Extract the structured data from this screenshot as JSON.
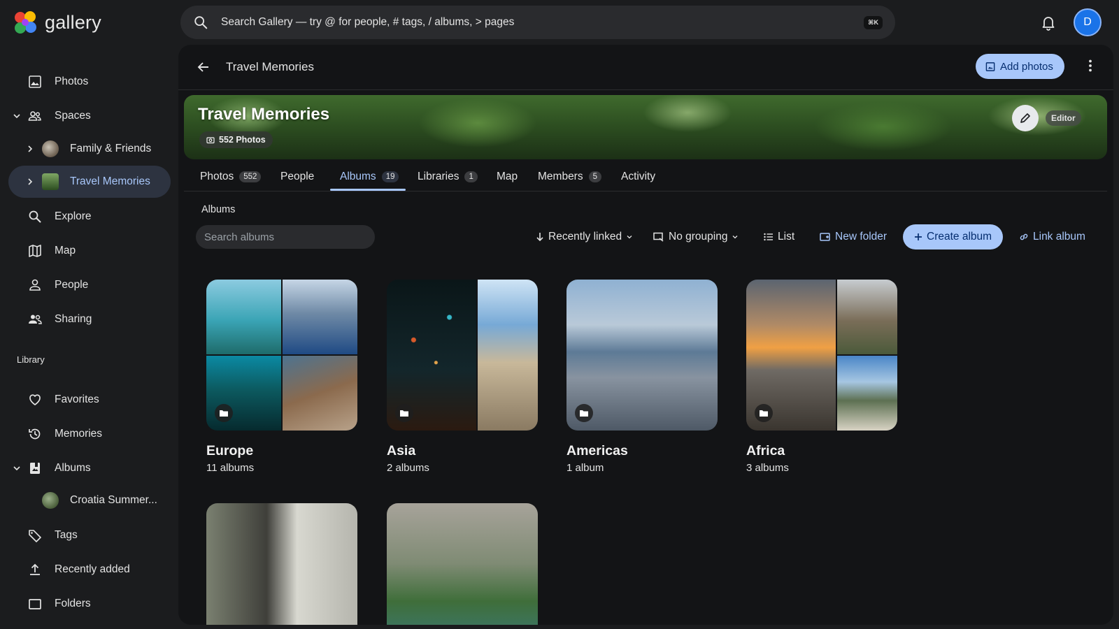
{
  "app": {
    "logo_text": "gallery"
  },
  "search": {
    "placeholder": "Search Gallery — try @ for people, # tags, / albums, > pages",
    "shortcut": "⌘K"
  },
  "user": {
    "avatar_letter": "D"
  },
  "sidebar": {
    "items": [
      {
        "label": "Photos",
        "icon": "photo-icon"
      },
      {
        "label": "Spaces",
        "icon": "group-icon"
      },
      {
        "label": "Family & Friends"
      },
      {
        "label": "Travel Memories",
        "active": true
      },
      {
        "label": "Explore",
        "icon": "search-icon"
      },
      {
        "label": "Map",
        "icon": "map-icon"
      },
      {
        "label": "People",
        "icon": "person-icon"
      },
      {
        "label": "Sharing",
        "icon": "sharing-icon"
      }
    ],
    "library_label": "Library",
    "library_items": [
      {
        "label": "Favorites",
        "icon": "heart-icon"
      },
      {
        "label": "Memories",
        "icon": "history-icon"
      },
      {
        "label": "Albums",
        "icon": "album-icon"
      },
      {
        "label": "Croatia Summer..."
      },
      {
        "label": "Tags",
        "icon": "tag-icon"
      },
      {
        "label": "Recently added",
        "icon": "upload-icon"
      },
      {
        "label": "Folders",
        "icon": "folder-icon"
      }
    ]
  },
  "header": {
    "title": "Travel Memories",
    "add_photos_label": "Add photos"
  },
  "banner": {
    "title": "Travel Memories",
    "photo_count": "552 Photos",
    "role": "Editor"
  },
  "tabs": [
    {
      "label": "Photos",
      "badge": "552"
    },
    {
      "label": "People",
      "badge": ""
    },
    {
      "label": "Albums",
      "badge": "19",
      "active": true
    },
    {
      "label": "Libraries",
      "badge": "1"
    },
    {
      "label": "Map",
      "badge": ""
    },
    {
      "label": "Members",
      "badge": "5"
    },
    {
      "label": "Activity",
      "badge": ""
    }
  ],
  "albums_section": {
    "title": "Albums",
    "search_placeholder": "Search albums",
    "sort_label": "Recently linked",
    "grouping_label": "No grouping",
    "view_label": "List",
    "new_folder_label": "New folder",
    "create_album_label": "Create album",
    "link_album_label": "Link album"
  },
  "albums": [
    {
      "name": "Europe",
      "count": "11 albums"
    },
    {
      "name": "Asia",
      "count": "2 albums"
    },
    {
      "name": "Americas",
      "count": "1 album"
    },
    {
      "name": "Africa",
      "count": "3 albums"
    }
  ],
  "colors": {
    "accent": "#a8c7fa",
    "accent_text": "#062e6f",
    "active_bg": "#2d3340",
    "panel_bg": "#131416",
    "page_bg": "#1b1c1e"
  }
}
